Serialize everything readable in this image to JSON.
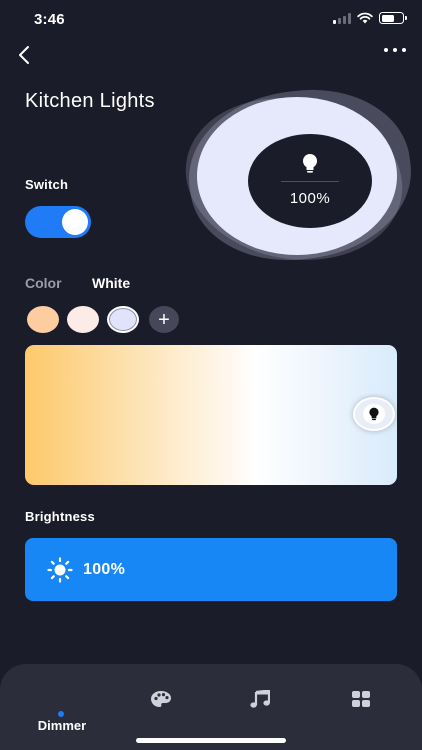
{
  "status_bar": {
    "time": "3:46"
  },
  "header": {
    "title": "Kitchen Lights"
  },
  "dial": {
    "percent": "100%",
    "level": 1.0
  },
  "switch": {
    "label": "Switch",
    "on": true
  },
  "mode_tabs": {
    "color": "Color",
    "white": "White",
    "selected": "White"
  },
  "swatches": [
    {
      "name": "warm",
      "color": "#fdcca1"
    },
    {
      "name": "neutral",
      "color": "#fcebe6"
    },
    {
      "name": "cool",
      "color": "#dfe3fb",
      "selected": true
    }
  ],
  "add_label": "+",
  "white_temperature": {
    "position_fraction": 0.98
  },
  "brightness": {
    "label": "Brightness",
    "value": "100%"
  },
  "nav": {
    "items": [
      {
        "label": "Dimmer",
        "icon": "lamp",
        "active": true
      },
      {
        "label": "",
        "icon": "palette-icon"
      },
      {
        "label": "",
        "icon": "music-note-icon"
      },
      {
        "label": "",
        "icon": "grid-icon"
      }
    ]
  },
  "colors": {
    "accent": "#1f7bf6",
    "background": "#1b1c29",
    "nav_background": "#2c2d3b"
  }
}
